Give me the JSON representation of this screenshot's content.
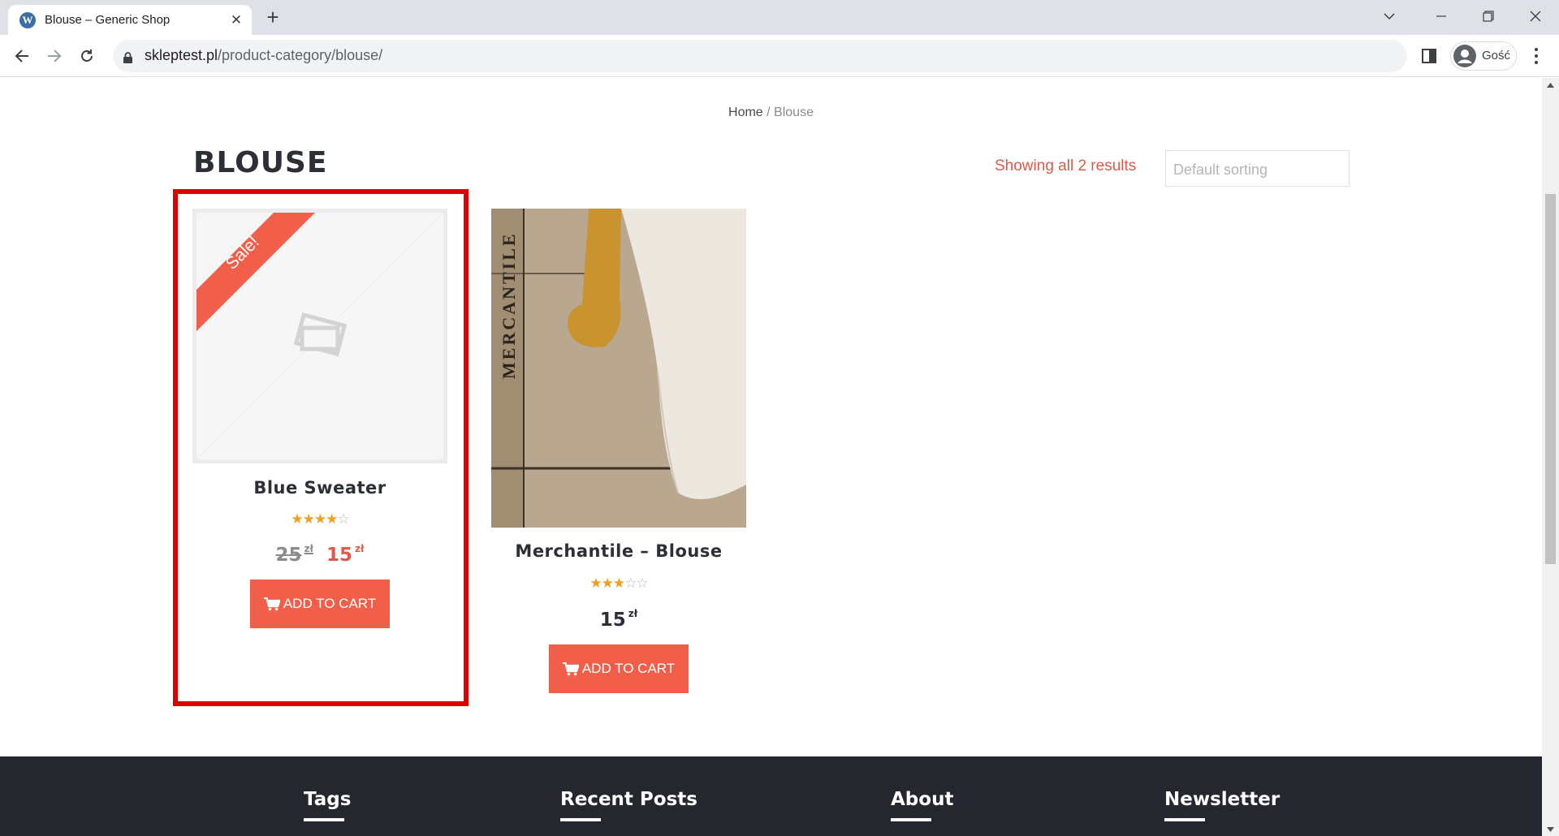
{
  "browser": {
    "tab_title": "Blouse – Generic Shop",
    "new_tab_symbol": "+",
    "url_host": "skleptest.pl",
    "url_path": "/product-category/blouse/",
    "profile_label": "Gość"
  },
  "breadcrumb": {
    "home": "Home",
    "separator": " / ",
    "current": "Blouse"
  },
  "page": {
    "title": "BLOUSE",
    "result_count": "Showing all 2 results",
    "sort_placeholder": "Default sorting"
  },
  "products": [
    {
      "name": "Blue Sweater",
      "sale_badge": "Sale!",
      "rating": 4,
      "rating_max": 5,
      "price_old": "25",
      "price_new": "15",
      "currency": "zł",
      "button_label": "ADD TO CART"
    },
    {
      "name": "Merchantile – Blouse",
      "image_text": "MERCANTILE",
      "rating": 3,
      "rating_max": 5,
      "price": "15",
      "currency": "zł",
      "button_label": "ADD TO CART"
    }
  ],
  "footer": {
    "headings": [
      "Tags",
      "Recent Posts",
      "About",
      "Newsletter"
    ]
  },
  "colors": {
    "accent": "#f15f4a",
    "highlight_border": "#dd0000",
    "footer_bg": "#25272e",
    "title_text": "#2d2f36"
  },
  "icons": [
    "wordpress-icon",
    "close-icon",
    "plus-icon",
    "chevron-down-icon",
    "minimize-icon",
    "restore-icon",
    "window-close-icon",
    "back-arrow-icon",
    "forward-arrow-icon",
    "reload-icon",
    "lock-icon",
    "side-panel-icon",
    "profile-icon",
    "more-menu-icon",
    "cart-icon",
    "star-icon"
  ]
}
